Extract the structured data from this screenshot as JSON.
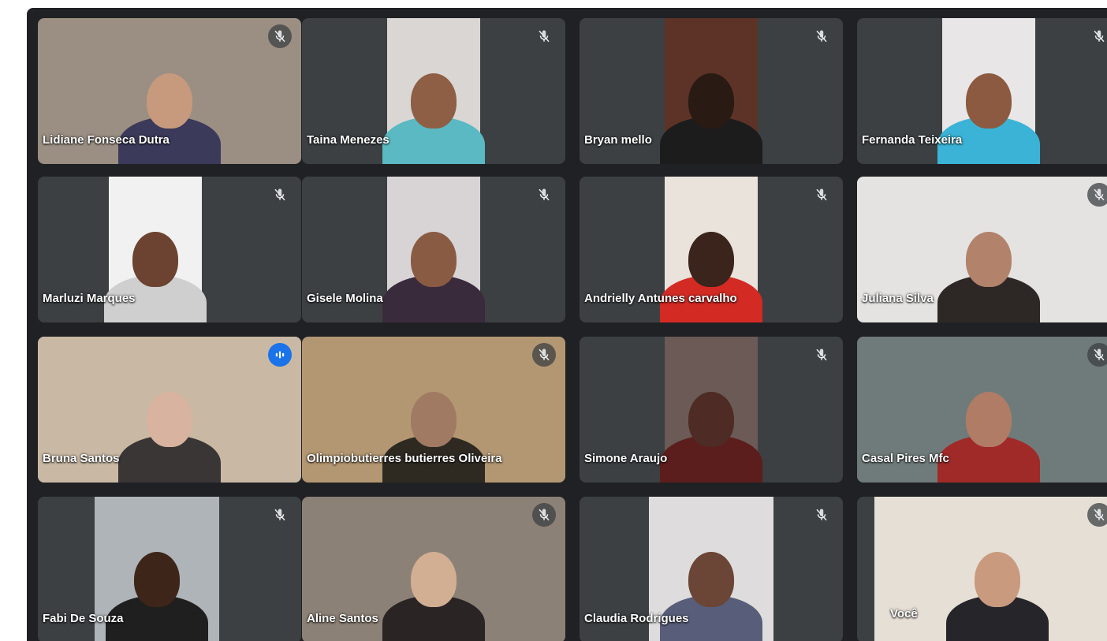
{
  "meeting": {
    "participants": [
      {
        "name": "Lidiane Fonseca Dutra",
        "mic": "muted",
        "bg": "#9a8f82",
        "skin": "#c79a7e",
        "shirt": "#3b3a5a"
      },
      {
        "name": "Taina Menezes",
        "mic": "muted",
        "bg": "#d9d6d4",
        "skin": "#8e5f45",
        "shirt": "#5ab9c2"
      },
      {
        "name": "Bryan mello",
        "mic": "muted",
        "bg": "#5c3326",
        "skin": "#2a1a14",
        "shirt": "#1c1c1c"
      },
      {
        "name": "Fernanda Teixeira",
        "mic": "muted",
        "bg": "#e8e6e6",
        "skin": "#8c5a40",
        "shirt": "#3bb3d6"
      },
      {
        "name": "Marluzi Marques",
        "mic": "muted",
        "bg": "#f1f1f1",
        "skin": "#6b4330",
        "shirt": "#cfcfcf"
      },
      {
        "name": "Gisele Molina",
        "mic": "muted",
        "bg": "#d8d4d6",
        "skin": "#8a5b43",
        "shirt": "#3a2b3c"
      },
      {
        "name": "Andrielly Antunes carvalho",
        "mic": "muted",
        "bg": "#e9e3dc",
        "skin": "#3a241b",
        "shirt": "#d42a24"
      },
      {
        "name": "Juliana Silva",
        "mic": "muted",
        "bg": "#e4e3e1",
        "skin": "#b2826b",
        "shirt": "#2d2726"
      },
      {
        "name": "Bruna Santos",
        "mic": "speaking",
        "bg": "#c9b9a4",
        "skin": "#d8b39f",
        "shirt": "#3a3636"
      },
      {
        "name": "Olimpiobutierres butierres Oliveira",
        "mic": "muted",
        "bg": "#b39772",
        "skin": "#a07a62",
        "shirt": "#2e2a22"
      },
      {
        "name": "Simone Araujo",
        "mic": "muted",
        "bg": "#6b5a56",
        "skin": "#4e2b24",
        "shirt": "#5b1e1c"
      },
      {
        "name": "Casal Pires Mfc",
        "mic": "muted",
        "bg": "#6f7b7a",
        "skin": "#b07c66",
        "shirt": "#a02a28"
      },
      {
        "name": "Fabi De Souza",
        "mic": "muted",
        "bg": "#aeb4b8",
        "skin": "#3d2619",
        "shirt": "#1f1f1f"
      },
      {
        "name": "Aline Santos",
        "mic": "muted",
        "bg": "#8c8176",
        "skin": "#d2ae93",
        "shirt": "#2a2424"
      },
      {
        "name": "Claudia Rodrigues",
        "mic": "muted",
        "bg": "#dedcdc",
        "skin": "#6b4535",
        "shirt": "#585e7a"
      },
      {
        "name": "Você",
        "mic": "muted",
        "bg": "#e6dfd6",
        "skin": "#c99a7e",
        "shirt": "#26252a"
      }
    ]
  },
  "icons": {
    "muted": "mic-off-icon",
    "speaking": "audio-level-icon"
  }
}
